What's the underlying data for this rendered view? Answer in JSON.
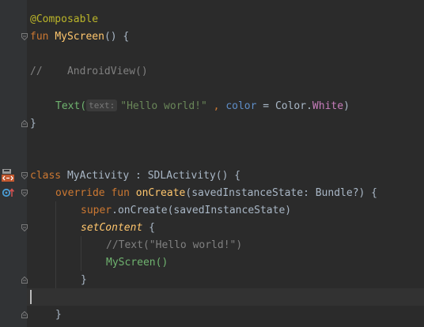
{
  "editor": {
    "language": "kotlin",
    "lines": {
      "l1": {
        "annotation": "@Composable"
      },
      "l2": {
        "kw": "fun",
        "name": "MyScreen",
        "rest": "() {"
      },
      "l4": {
        "comment": "//    AndroidView()"
      },
      "l6": {
        "call": "Text(",
        "hint": "text:",
        "string": "\"Hello world!\"",
        "sep": " , ",
        "param": "color",
        "eq": " = ",
        "cls": "Color.",
        "member": "White",
        "close": ")"
      },
      "l7": {
        "brace": "}"
      },
      "l10": {
        "kw": "class",
        "name": " MyActivity : SDLActivity() {"
      },
      "l11": {
        "kw": "override fun",
        "name": "onCreate",
        "rest": "(savedInstanceState: Bundle?) {"
      },
      "l12": {
        "kw": "super",
        "rest": ".onCreate(savedInstanceState)"
      },
      "l13": {
        "name": "setContent",
        "rest": " {"
      },
      "l14": {
        "comment": "//Text(\"Hello world!\")"
      },
      "l15": {
        "call": "MyScreen()"
      },
      "l16": {
        "brace": "}"
      },
      "l18": {
        "brace": "}"
      }
    }
  },
  "colors": {
    "background": "#2b2b2b",
    "gutter": "#313335",
    "keyword": "#cc7832",
    "annotation": "#bbb529",
    "function": "#ffc66d",
    "string": "#6a8759",
    "comment": "#808080",
    "composable": "#6fb36f"
  }
}
